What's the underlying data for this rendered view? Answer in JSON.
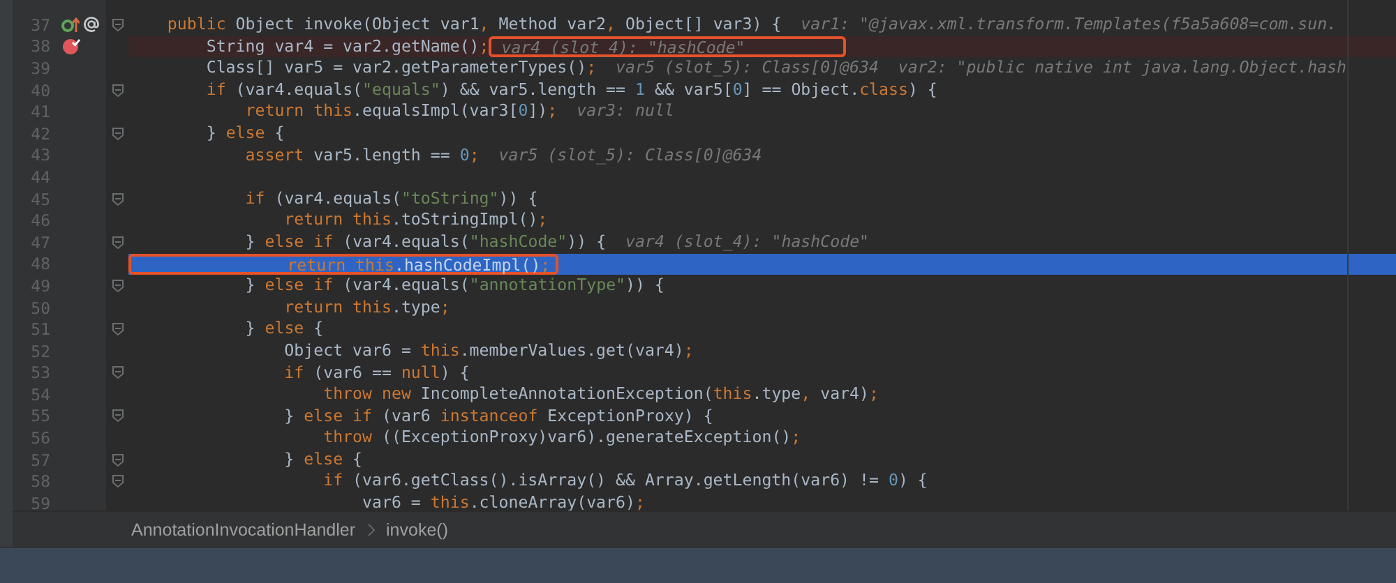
{
  "editor": {
    "lines": [
      {
        "number": "37",
        "fold": true,
        "breakpoint": false,
        "current": false,
        "markers": [
          {
            "kind": "override"
          },
          {
            "kind": "annotation"
          }
        ],
        "tokens": [
          {
            "kind": "keyword",
            "text": "    public"
          },
          {
            "kind": "plain",
            "text": " Object invoke(Object var1"
          },
          {
            "kind": "keyword",
            "text": ","
          },
          {
            "kind": "plain",
            "text": " Method var2"
          },
          {
            "kind": "keyword",
            "text": ","
          },
          {
            "kind": "plain",
            "text": " Object[] var3) {"
          },
          {
            "kind": "hint",
            "text": "  var1: \"@javax.xml.transform.Templates(f5a5a608=com.sun."
          }
        ]
      },
      {
        "number": "38",
        "fold": false,
        "breakpoint": true,
        "current": false,
        "tokens": [
          {
            "kind": "plain",
            "text": "        String var4 = var2.getName()"
          },
          {
            "kind": "keyword",
            "text": ";"
          },
          {
            "kind": "hint",
            "text": " var4 (slot_4): \"hashCode\"",
            "boxed": true
          }
        ]
      },
      {
        "number": "39",
        "fold": false,
        "breakpoint": false,
        "current": false,
        "tokens": [
          {
            "kind": "plain",
            "text": "        Class[] var5 = var2.getParameterTypes()"
          },
          {
            "kind": "keyword",
            "text": ";"
          },
          {
            "kind": "hint",
            "text": "  var5 (slot_5): Class[0]@634  var2: \"public native int java.lang.Object.hash"
          }
        ]
      },
      {
        "number": "40",
        "fold": true,
        "breakpoint": false,
        "current": false,
        "tokens": [
          {
            "kind": "keyword",
            "text": "        if"
          },
          {
            "kind": "plain",
            "text": " (var4.equals("
          },
          {
            "kind": "string",
            "text": "\"equals\""
          },
          {
            "kind": "plain",
            "text": ") && var5.length == "
          },
          {
            "kind": "number",
            "text": "1"
          },
          {
            "kind": "plain",
            "text": " && var5["
          },
          {
            "kind": "number",
            "text": "0"
          },
          {
            "kind": "plain",
            "text": "] == Object."
          },
          {
            "kind": "keyword",
            "text": "class"
          },
          {
            "kind": "plain",
            "text": ") {"
          }
        ]
      },
      {
        "number": "41",
        "fold": false,
        "breakpoint": false,
        "current": false,
        "tokens": [
          {
            "kind": "keyword",
            "text": "            return this"
          },
          {
            "kind": "plain",
            "text": ".equalsImpl(var3["
          },
          {
            "kind": "number",
            "text": "0"
          },
          {
            "kind": "plain",
            "text": "])"
          },
          {
            "kind": "keyword",
            "text": ";"
          },
          {
            "kind": "hint",
            "text": "  var3: null"
          }
        ]
      },
      {
        "number": "42",
        "fold": true,
        "breakpoint": false,
        "current": false,
        "tokens": [
          {
            "kind": "plain",
            "text": "        } "
          },
          {
            "kind": "keyword",
            "text": "else"
          },
          {
            "kind": "plain",
            "text": " {"
          }
        ]
      },
      {
        "number": "43",
        "fold": false,
        "breakpoint": false,
        "current": false,
        "tokens": [
          {
            "kind": "keyword",
            "text": "            assert"
          },
          {
            "kind": "plain",
            "text": " var5.length == "
          },
          {
            "kind": "number",
            "text": "0"
          },
          {
            "kind": "keyword",
            "text": ";"
          },
          {
            "kind": "hint",
            "text": "  var5 (slot_5): Class[0]@634"
          }
        ]
      },
      {
        "number": "44",
        "fold": false,
        "breakpoint": false,
        "current": false
      },
      {
        "number": "45",
        "fold": true,
        "breakpoint": false,
        "current": false,
        "tokens": [
          {
            "kind": "keyword",
            "text": "            if"
          },
          {
            "kind": "plain",
            "text": " (var4.equals("
          },
          {
            "kind": "string",
            "text": "\"toString\""
          },
          {
            "kind": "plain",
            "text": ")) {"
          }
        ]
      },
      {
        "number": "46",
        "fold": false,
        "breakpoint": false,
        "current": false,
        "tokens": [
          {
            "kind": "keyword",
            "text": "                return this"
          },
          {
            "kind": "plain",
            "text": ".toStringImpl()"
          },
          {
            "kind": "keyword",
            "text": ";"
          }
        ]
      },
      {
        "number": "47",
        "fold": true,
        "breakpoint": false,
        "current": false,
        "tokens": [
          {
            "kind": "plain",
            "text": "            } "
          },
          {
            "kind": "keyword",
            "text": "else if"
          },
          {
            "kind": "plain",
            "text": " (var4.equals("
          },
          {
            "kind": "string",
            "text": "\"hashCode\""
          },
          {
            "kind": "plain",
            "text": ")) {"
          },
          {
            "kind": "hint",
            "text": "  var4 (slot_4): \"hashCode\""
          }
        ]
      },
      {
        "number": "48",
        "fold": false,
        "breakpoint": false,
        "current": true,
        "tokens": [
          {
            "kind": "keyword",
            "text": "                return this",
            "boxed": true
          },
          {
            "kind": "plain",
            "text": ".hashCodeImpl()",
            "boxed": true
          },
          {
            "kind": "keyword",
            "text": ";",
            "boxed": true
          }
        ]
      },
      {
        "number": "49",
        "fold": true,
        "breakpoint": false,
        "current": false,
        "tokens": [
          {
            "kind": "plain",
            "text": "            } "
          },
          {
            "kind": "keyword",
            "text": "else if"
          },
          {
            "kind": "plain",
            "text": " (var4.equals("
          },
          {
            "kind": "string",
            "text": "\"annotationType\""
          },
          {
            "kind": "plain",
            "text": ")) {"
          }
        ]
      },
      {
        "number": "50",
        "fold": false,
        "breakpoint": false,
        "current": false,
        "tokens": [
          {
            "kind": "keyword",
            "text": "                return this"
          },
          {
            "kind": "plain",
            "text": ".type"
          },
          {
            "kind": "keyword",
            "text": ";"
          }
        ]
      },
      {
        "number": "51",
        "fold": true,
        "breakpoint": false,
        "current": false,
        "tokens": [
          {
            "kind": "plain",
            "text": "            } "
          },
          {
            "kind": "keyword",
            "text": "else"
          },
          {
            "kind": "plain",
            "text": " {"
          }
        ]
      },
      {
        "number": "52",
        "fold": false,
        "breakpoint": false,
        "current": false,
        "tokens": [
          {
            "kind": "plain",
            "text": "                Object var6 = "
          },
          {
            "kind": "keyword",
            "text": "this"
          },
          {
            "kind": "plain",
            "text": ".memberValues.get(var4)"
          },
          {
            "kind": "keyword",
            "text": ";"
          }
        ]
      },
      {
        "number": "53",
        "fold": true,
        "breakpoint": false,
        "current": false,
        "tokens": [
          {
            "kind": "keyword",
            "text": "                if"
          },
          {
            "kind": "plain",
            "text": " (var6 == "
          },
          {
            "kind": "keyword",
            "text": "null"
          },
          {
            "kind": "plain",
            "text": ") {"
          }
        ]
      },
      {
        "number": "54",
        "fold": false,
        "breakpoint": false,
        "current": false,
        "tokens": [
          {
            "kind": "keyword",
            "text": "                    throw new"
          },
          {
            "kind": "plain",
            "text": " IncompleteAnnotationException("
          },
          {
            "kind": "keyword",
            "text": "this"
          },
          {
            "kind": "plain",
            "text": ".type"
          },
          {
            "kind": "keyword",
            "text": ","
          },
          {
            "kind": "plain",
            "text": " var4)"
          },
          {
            "kind": "keyword",
            "text": ";"
          }
        ]
      },
      {
        "number": "55",
        "fold": true,
        "breakpoint": false,
        "current": false,
        "tokens": [
          {
            "kind": "plain",
            "text": "                } "
          },
          {
            "kind": "keyword",
            "text": "else if"
          },
          {
            "kind": "plain",
            "text": " (var6 "
          },
          {
            "kind": "keyword",
            "text": "instanceof"
          },
          {
            "kind": "plain",
            "text": " ExceptionProxy) {"
          }
        ]
      },
      {
        "number": "56",
        "fold": false,
        "breakpoint": false,
        "current": false,
        "tokens": [
          {
            "kind": "keyword",
            "text": "                    throw"
          },
          {
            "kind": "plain",
            "text": " ((ExceptionProxy)var6).generateException()"
          },
          {
            "kind": "keyword",
            "text": ";"
          }
        ]
      },
      {
        "number": "57",
        "fold": true,
        "breakpoint": false,
        "current": false,
        "tokens": [
          {
            "kind": "plain",
            "text": "                } "
          },
          {
            "kind": "keyword",
            "text": "else"
          },
          {
            "kind": "plain",
            "text": " {"
          }
        ]
      },
      {
        "number": "58",
        "fold": true,
        "breakpoint": false,
        "current": false,
        "tokens": [
          {
            "kind": "keyword",
            "text": "                    if"
          },
          {
            "kind": "plain",
            "text": " (var6.getClass().isArray() && Array.getLength(var6) != "
          },
          {
            "kind": "number",
            "text": "0"
          },
          {
            "kind": "plain",
            "text": ") {"
          }
        ]
      },
      {
        "number": "59",
        "fold": false,
        "breakpoint": false,
        "current": false,
        "tokens": [
          {
            "kind": "plain",
            "text": "                        var6 = "
          },
          {
            "kind": "keyword",
            "text": "this"
          },
          {
            "kind": "plain",
            "text": ".cloneArray(var6)"
          },
          {
            "kind": "keyword",
            "text": ";"
          }
        ]
      }
    ]
  },
  "breadcrumbs": [
    "AnnotationInvocationHandler",
    "invoke()"
  ]
}
